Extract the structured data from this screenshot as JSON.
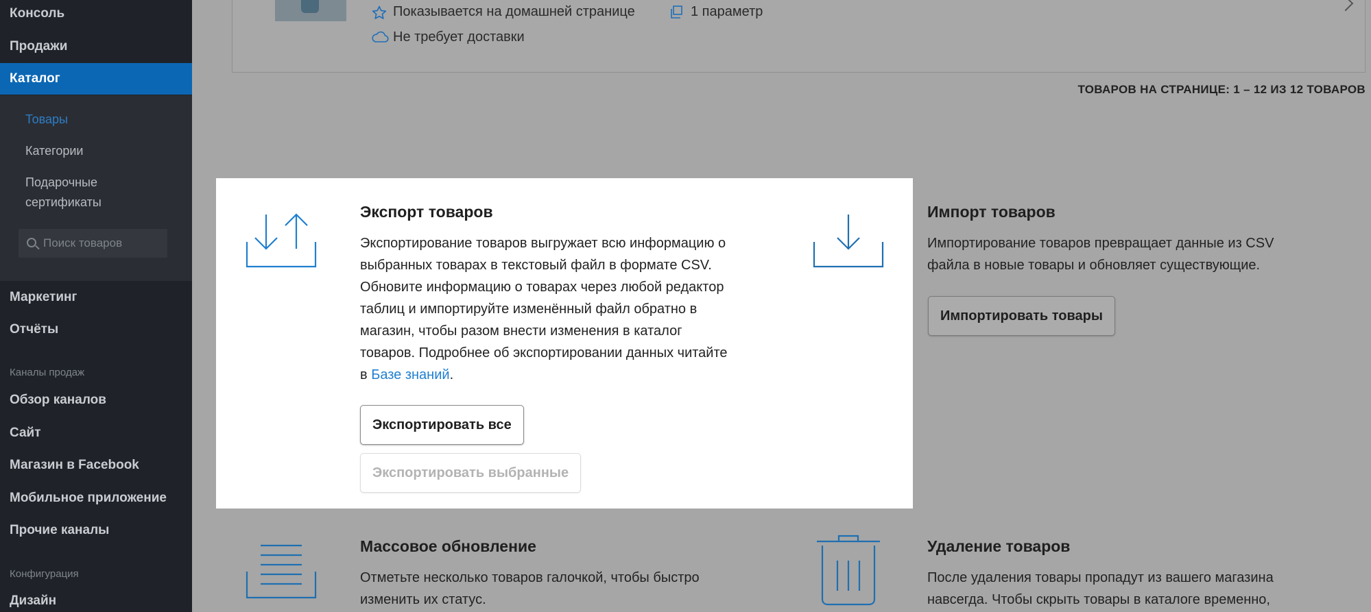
{
  "sidebar": {
    "items": [
      {
        "label": "Консоль"
      },
      {
        "label": "Продажи"
      },
      {
        "label": "Каталог"
      }
    ],
    "catalog_sub": {
      "products": "Товары",
      "categories": "Категории",
      "gift_line1": "Подарочные",
      "gift_line2": "сертификаты"
    },
    "search_placeholder": "Поиск товаров",
    "marketing": "Маркетинг",
    "reports": "Отчёты",
    "channels_group": "Каналы продаж",
    "channels": [
      {
        "label": "Обзор каналов"
      },
      {
        "label": "Сайт"
      },
      {
        "label": "Магазин в Facebook"
      },
      {
        "label": "Мобильное приложение"
      },
      {
        "label": "Прочие каналы"
      }
    ],
    "config_group": "Конфигурация",
    "design": "Дизайн"
  },
  "product_card": {
    "featured": "Показывается на домашней странице",
    "options": "1 параметр",
    "shipping": "Не требует доставки",
    "icons": {
      "featured": "star-icon",
      "options": "copies-icon",
      "shipping": "cloud-icon"
    }
  },
  "pagination": {
    "summary": "ТОВАРОВ НА СТРАНИЦЕ: 1 – 12 ИЗ 12 ТОВАРОВ"
  },
  "export": {
    "title": "Экспорт товаров",
    "desc_lines": [
      "Экспортирование товаров выгружает всю информацию о",
      "выбранных товарах в текстовый файл в формате CSV.",
      "Обновите информацию о товарах через любой редактор",
      "таблиц и импортируйте изменённый файл обратно в",
      "магазин, чтобы разом внести изменения в каталог",
      "товаров. Подробнее об экспортировании данных читайте"
    ],
    "desc_prefix": "в ",
    "link": "Базе знаний",
    "desc_suffix": ".",
    "export_all": "Экспортировать все",
    "export_selected": "Экспортировать выбранные"
  },
  "import": {
    "title": "Импорт товаров",
    "desc_lines": [
      "Импортирование товаров превращает данные из CSV",
      "файла в новые товары и обновляет существующие."
    ],
    "button": "Импортировать товары"
  },
  "bulk": {
    "title": "Массовое обновление",
    "desc_lines": [
      "Отметьте несколько товаров галочкой, чтобы быстро",
      "изменить их статус."
    ]
  },
  "delete": {
    "title": "Удаление товаров",
    "desc_lines": [
      "После удаления товары пропадут из вашего магазина",
      "навсегда. Чтобы скрыть товары в каталоге временно,"
    ]
  },
  "colors": {
    "sidebar_bg": "#1f2329",
    "active_nav": "#0b67b4",
    "accent": "#1f7fcf",
    "overlay_bg": "#a6a6a6"
  }
}
